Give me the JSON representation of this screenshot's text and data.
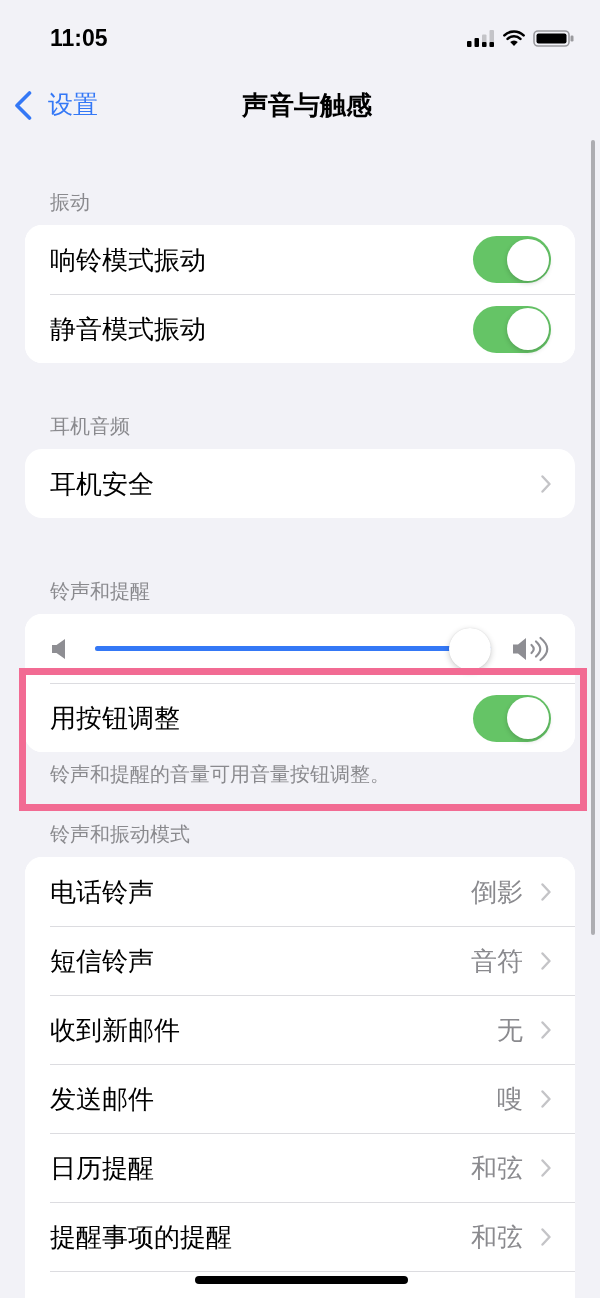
{
  "status_bar": {
    "time": "11:05"
  },
  "nav": {
    "back_label": "设置",
    "title": "声音与触感"
  },
  "sections": [
    {
      "header": "振动",
      "rows": [
        {
          "kind": "toggle",
          "label": "响铃模式振动",
          "on": true
        },
        {
          "kind": "toggle",
          "label": "静音模式振动",
          "on": true
        }
      ]
    },
    {
      "header": "耳机音频",
      "rows": [
        {
          "kind": "link",
          "label": "耳机安全"
        }
      ]
    },
    {
      "header": "铃声和提醒",
      "rows": [
        {
          "kind": "slider",
          "level": 1
        },
        {
          "kind": "toggle",
          "label": "用按钮调整",
          "on": true
        }
      ],
      "footer": "铃声和提醒的音量可用音量按钮调整。",
      "highlighted": true
    },
    {
      "header": "铃声和振动模式",
      "rows": [
        {
          "kind": "link",
          "label": "电话铃声",
          "value": "倒影"
        },
        {
          "kind": "link",
          "label": "短信铃声",
          "value": "音符"
        },
        {
          "kind": "link",
          "label": "收到新邮件",
          "value": "无"
        },
        {
          "kind": "link",
          "label": "发送邮件",
          "value": "嗖"
        },
        {
          "kind": "link",
          "label": "日历提醒",
          "value": "和弦"
        },
        {
          "kind": "link",
          "label": "提醒事项的提醒",
          "value": "和弦"
        }
      ]
    }
  ]
}
